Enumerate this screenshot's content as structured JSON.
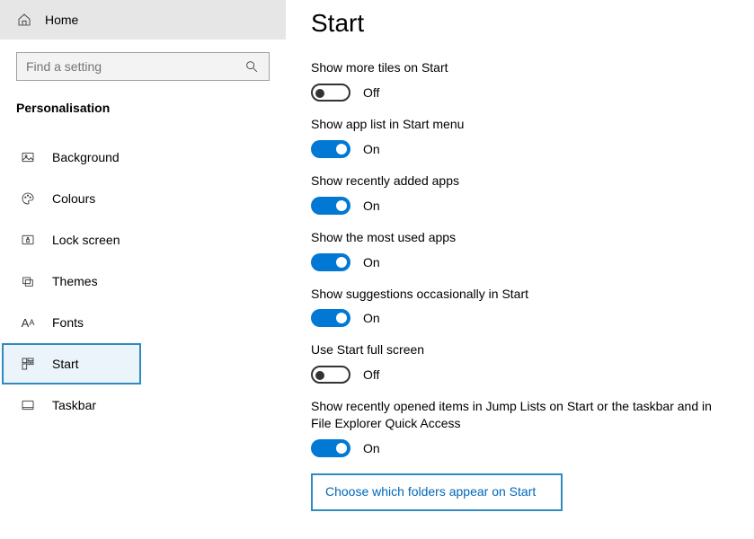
{
  "header": {
    "home_label": "Home"
  },
  "search": {
    "placeholder": "Find a setting"
  },
  "category": {
    "title": "Personalisation"
  },
  "sidebar": {
    "items": [
      {
        "label": "Background"
      },
      {
        "label": "Colours"
      },
      {
        "label": "Lock screen"
      },
      {
        "label": "Themes"
      },
      {
        "label": "Fonts"
      },
      {
        "label": "Start"
      },
      {
        "label": "Taskbar"
      }
    ]
  },
  "main": {
    "title": "Start",
    "settings": [
      {
        "label": "Show more tiles on Start",
        "state": "Off",
        "on": false
      },
      {
        "label": "Show app list in Start menu",
        "state": "On",
        "on": true
      },
      {
        "label": "Show recently added apps",
        "state": "On",
        "on": true
      },
      {
        "label": "Show the most used apps",
        "state": "On",
        "on": true
      },
      {
        "label": "Show suggestions occasionally in Start",
        "state": "On",
        "on": true
      },
      {
        "label": "Use Start full screen",
        "state": "Off",
        "on": false
      },
      {
        "label": "Show recently opened items in Jump Lists on Start or the taskbar and in File Explorer Quick Access",
        "state": "On",
        "on": true
      }
    ],
    "link": "Choose which folders appear on Start"
  }
}
